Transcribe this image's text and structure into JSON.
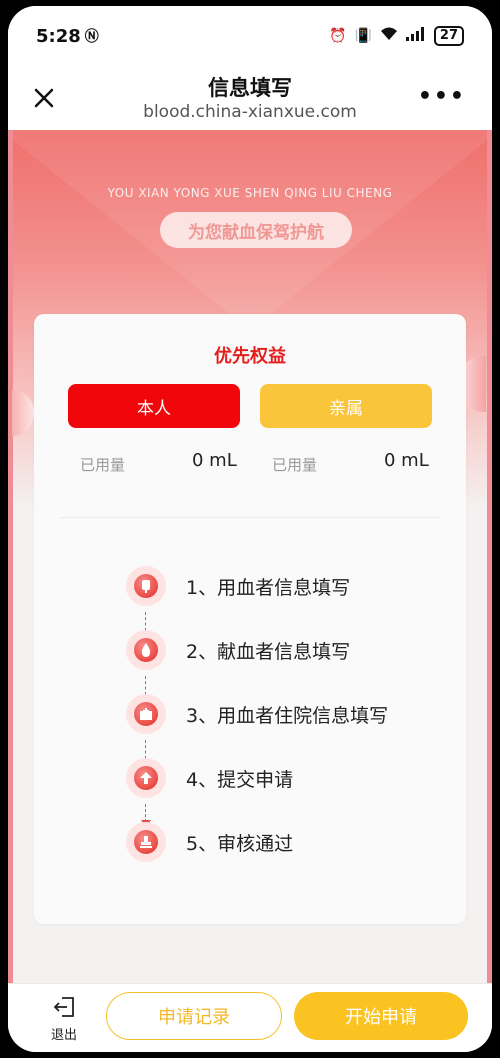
{
  "status_bar": {
    "time": "5:28",
    "battery": "27"
  },
  "nav": {
    "title": "信息填写",
    "url": "blood.china-xianxue.com"
  },
  "hero": {
    "subtitle": "YOU XIAN YONG XUE SHEN QING LIU CHENG",
    "tagline": "为您献血保驾护航"
  },
  "benefits": {
    "title": "优先权益",
    "tabs": [
      {
        "label": "本人",
        "color": "#f0060b"
      },
      {
        "label": "亲属",
        "color": "#fac43b"
      }
    ],
    "usage": [
      {
        "label": "已用量",
        "value": "0 mL"
      },
      {
        "label": "已用量",
        "value": "0 mL"
      }
    ]
  },
  "steps": [
    {
      "label": "1、用血者信息填写",
      "icon": "blood-bag-icon"
    },
    {
      "label": "2、献血者信息填写",
      "icon": "blood-drop-icon"
    },
    {
      "label": "3、用血者住院信息填写",
      "icon": "hospital-icon"
    },
    {
      "label": "4、提交申请",
      "icon": "upload-icon"
    },
    {
      "label": "5、审核通过",
      "icon": "stamp-icon"
    }
  ],
  "bottom": {
    "exit_label": "退出",
    "records_label": "申请记录",
    "start_label": "开始申请"
  },
  "colors": {
    "primary_red": "#e3201e",
    "accent_yellow": "#fac322"
  }
}
